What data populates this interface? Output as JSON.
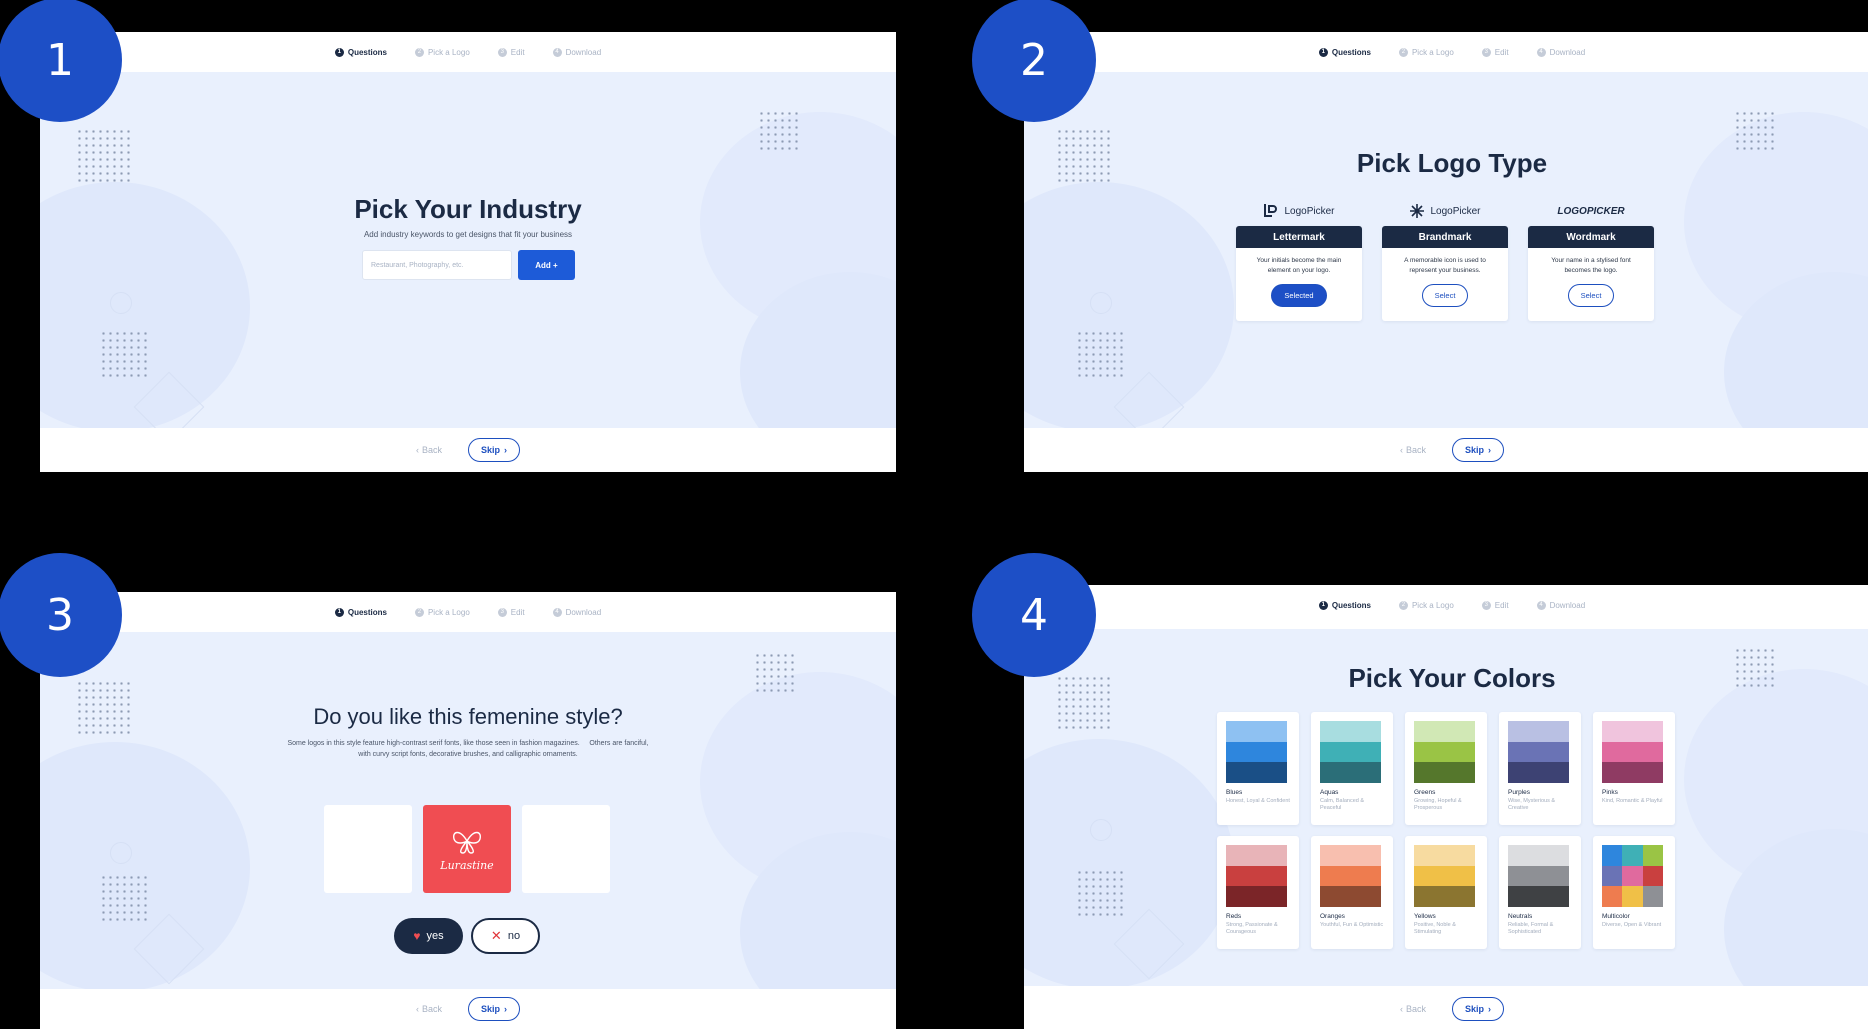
{
  "badges": [
    "1",
    "2",
    "3",
    "4"
  ],
  "steps": [
    "Questions",
    "Pick a Logo",
    "Edit",
    "Download"
  ],
  "step_numbers": [
    "1",
    "2",
    "3",
    "4"
  ],
  "nav": {
    "back": "Back",
    "skip": "Skip"
  },
  "panel1": {
    "title": "Pick Your Industry",
    "subtitle": "Add industry keywords to get designs that fit your business",
    "input_placeholder": "Restaurant, Photography, etc.",
    "add_label": "Add +"
  },
  "panel2": {
    "title": "Pick Logo Type",
    "types": [
      {
        "logo_text": "LogoPicker",
        "name": "Lettermark",
        "desc": "Your initials become the main element on your logo.",
        "button": "Selected",
        "selected": true
      },
      {
        "logo_text": "LogoPicker",
        "name": "Brandmark",
        "desc": "A memorable icon is used to represent your business.",
        "button": "Select",
        "selected": false
      },
      {
        "logo_text": "LOGOPICKER",
        "name": "Wordmark",
        "desc": "Your name in a stylised font becomes the logo.",
        "button": "Select",
        "selected": false
      }
    ]
  },
  "panel3": {
    "title": "Do you like this femenine style?",
    "desc_line1": "Some logos in this style feature high-contrast serif fonts, like those seen in fashion magazines.     Others are fanciful,",
    "desc_line2": "with curvy script fonts, decorative brushes, and calligraphic ornaments.",
    "sample_brand": "Lurastine",
    "yes": "yes",
    "no": "no"
  },
  "panel4": {
    "title": "Pick Your Colors",
    "palettes": [
      {
        "name": "Blues",
        "desc": "Honest, Loyal & Confident",
        "colors": [
          "#8ec1f2",
          "#2e86dd",
          "#1a4f86"
        ]
      },
      {
        "name": "Aquas",
        "desc": "Calm, Balanced & Peaceful",
        "colors": [
          "#a8dde0",
          "#3fb0b6",
          "#2b6e78"
        ]
      },
      {
        "name": "Greens",
        "desc": "Growing, Hopeful & Prosperous",
        "colors": [
          "#d1e8b5",
          "#9ac445",
          "#55772c"
        ]
      },
      {
        "name": "Purples",
        "desc": "Wise, Mysterious & Creative",
        "colors": [
          "#b9c0e3",
          "#6a73b5",
          "#3d4273"
        ]
      },
      {
        "name": "Pinks",
        "desc": "Kind, Romantic & Playful",
        "colors": [
          "#f0c4dd",
          "#e06a9e",
          "#8f3b63"
        ]
      },
      {
        "name": "Reds",
        "desc": "Strong, Passionate & Courageous",
        "colors": [
          "#e8b4b8",
          "#c9403f",
          "#7b2528"
        ]
      },
      {
        "name": "Oranges",
        "desc": "Youthful, Fun & Optimistic",
        "colors": [
          "#f8bfaf",
          "#ee7c4f",
          "#8d4a31"
        ]
      },
      {
        "name": "Yellows",
        "desc": "Positive, Noble & Stimulating",
        "colors": [
          "#f7dba0",
          "#f0c047",
          "#8b7530"
        ]
      },
      {
        "name": "Neutrals",
        "desc": "Reliable, Formal & Sophisticated",
        "colors": [
          "#dcdde0",
          "#8e9095",
          "#3f4144"
        ]
      },
      {
        "name": "Multicolor",
        "desc": "Diverse, Open & Vibrant",
        "colors": [
          "#2e86dd",
          "#3fb0b6",
          "#9ac445",
          "#6a73b5",
          "#e06a9e",
          "#c9403f",
          "#ee7c4f",
          "#f0c047",
          "#8e9095"
        ]
      }
    ]
  }
}
